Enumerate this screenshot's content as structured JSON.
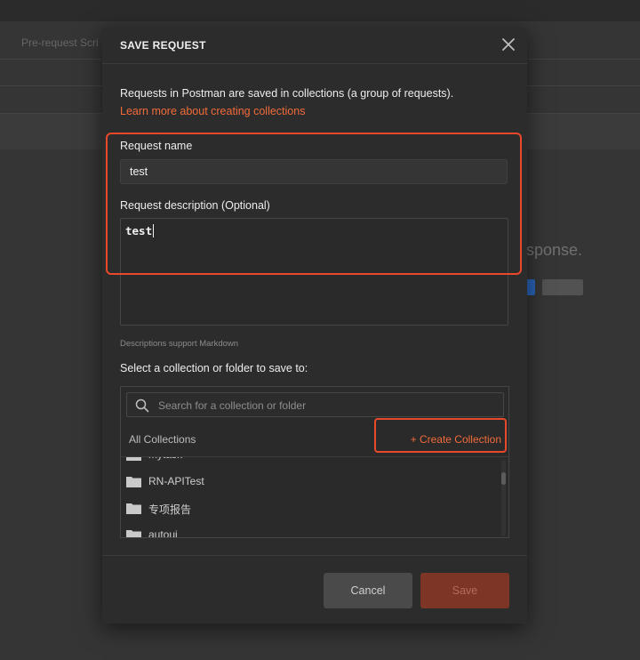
{
  "background": {
    "prerequest_tab": "Pre-request Scri",
    "response_hint": "sponse."
  },
  "modal": {
    "title": "SAVE REQUEST",
    "intro": "Requests in Postman are saved in collections (a group of requests).",
    "learn_link": "Learn more about creating collections",
    "name_label": "Request name",
    "name_value": "test",
    "desc_label": "Request description (Optional)",
    "desc_value": "test",
    "markdown_note": "Descriptions support Markdown",
    "collection_label": "Select a collection or folder to save to:",
    "search_placeholder": "Search for a collection or folder",
    "all_collections": "All Collections",
    "create_collection": "+ Create Collection",
    "items": [
      {
        "label": "mytask",
        "icon": "folder-icon"
      },
      {
        "label": "RN-APITest",
        "icon": "folder-icon"
      },
      {
        "label": "专项报告",
        "icon": "folder-icon"
      },
      {
        "label": "autoui",
        "icon": "folder-icon"
      }
    ],
    "cancel_label": "Cancel",
    "save_label": "Save"
  },
  "colors": {
    "accent": "#f26b3a",
    "highlight": "#e8492b",
    "modal_bg": "#2c2c2c",
    "save_disabled": "#7d3526"
  }
}
